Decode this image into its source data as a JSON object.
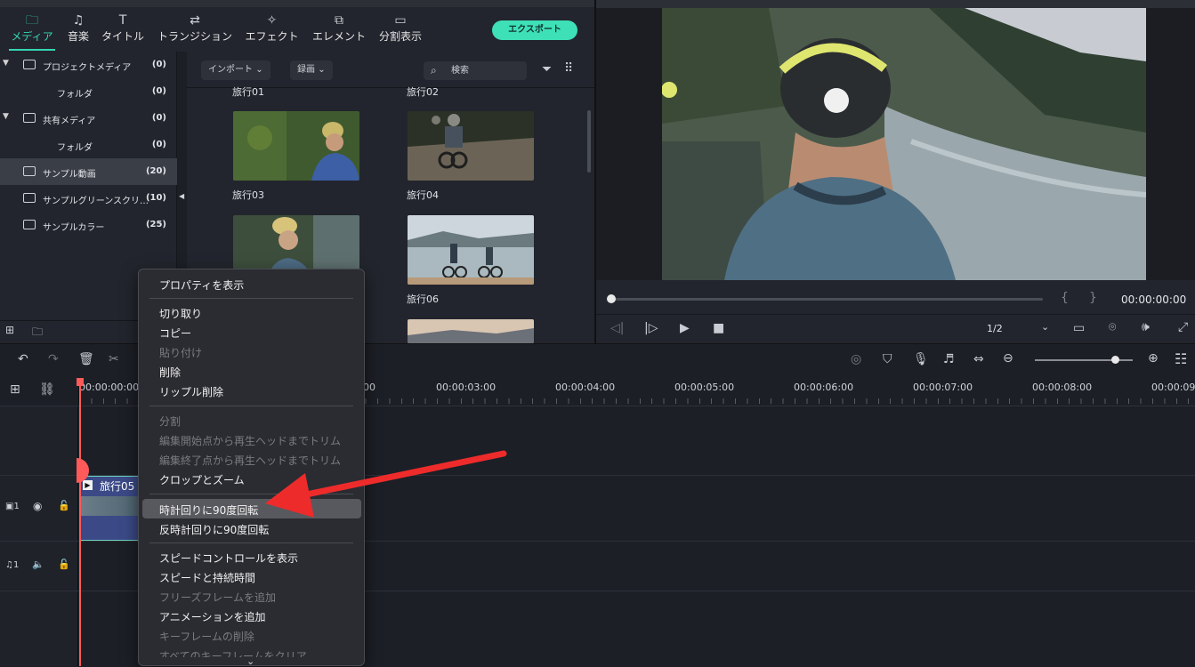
{
  "tabs": [
    {
      "label": "メディア",
      "icon": "folder-icon"
    },
    {
      "label": "音楽",
      "icon": "music-note-icon"
    },
    {
      "label": "タイトル",
      "icon": "text-icon"
    },
    {
      "label": "トランジション",
      "icon": "transition-icon"
    },
    {
      "label": "エフェクト",
      "icon": "effect-icon"
    },
    {
      "label": "エレメント",
      "icon": "element-icon"
    },
    {
      "label": "分割表示",
      "icon": "split-screen-icon"
    }
  ],
  "export_label": "エクスポート",
  "tree": [
    {
      "label": "プロジェクトメディア",
      "count": "(0)"
    },
    {
      "label": "フォルダ",
      "count": "(0)"
    },
    {
      "label": "共有メディア",
      "count": "(0)"
    },
    {
      "label": "フォルダ",
      "count": "(0)"
    },
    {
      "label": "サンプル動画",
      "count": "(20)"
    },
    {
      "label": "サンプルグリーンスクリ…",
      "count": "(10)"
    },
    {
      "label": "サンプルカラー",
      "count": "(25)"
    }
  ],
  "media": {
    "import_label": "インポート",
    "record_label": "録画",
    "search_placeholder": "検索",
    "items": [
      "旅行01",
      "旅行02",
      "旅行03",
      "旅行04",
      "旅行06"
    ]
  },
  "player": {
    "timecode": "00:00:00:00",
    "zoom": "1/2",
    "mark_in": "{",
    "mark_out": "}"
  },
  "ruler": [
    "00:00:00:00",
    "00",
    "00:00:03:00",
    "00:00:04:00",
    "00:00:05:00",
    "00:00:06:00",
    "00:00:07:00",
    "00:00:08:00",
    "00:00:09"
  ],
  "tracks": {
    "video": "1",
    "audio": "1"
  },
  "clip_label": "旅行05",
  "context_menu": [
    {
      "label": "プロパティを表示",
      "enabled": true
    },
    {
      "label": "切り取り",
      "enabled": true
    },
    {
      "label": "コピー",
      "enabled": true
    },
    {
      "label": "貼り付け",
      "enabled": false
    },
    {
      "label": "削除",
      "enabled": true
    },
    {
      "label": "リップル削除",
      "enabled": true
    },
    {
      "label": "分割",
      "enabled": false
    },
    {
      "label": "編集開始点から再生ヘッドまでトリム",
      "enabled": false
    },
    {
      "label": "編集終了点から再生ヘッドまでトリム",
      "enabled": false
    },
    {
      "label": "クロップとズーム",
      "enabled": true
    },
    {
      "label": "時計回りに90度回転",
      "enabled": true
    },
    {
      "label": "反時計回りに90度回転",
      "enabled": true
    },
    {
      "label": "スピードコントロールを表示",
      "enabled": true
    },
    {
      "label": "スピードと持続時間",
      "enabled": true
    },
    {
      "label": "フリーズフレームを追加",
      "enabled": false
    },
    {
      "label": "アニメーションを追加",
      "enabled": true
    },
    {
      "label": "キーフレームの削除",
      "enabled": false
    },
    {
      "label": "すべてのキーフレームをクリア",
      "enabled": false
    }
  ],
  "colors": {
    "accent": "#35d6b4",
    "arrow": "#ee2b2b",
    "playhead": "#ff5a5a"
  }
}
